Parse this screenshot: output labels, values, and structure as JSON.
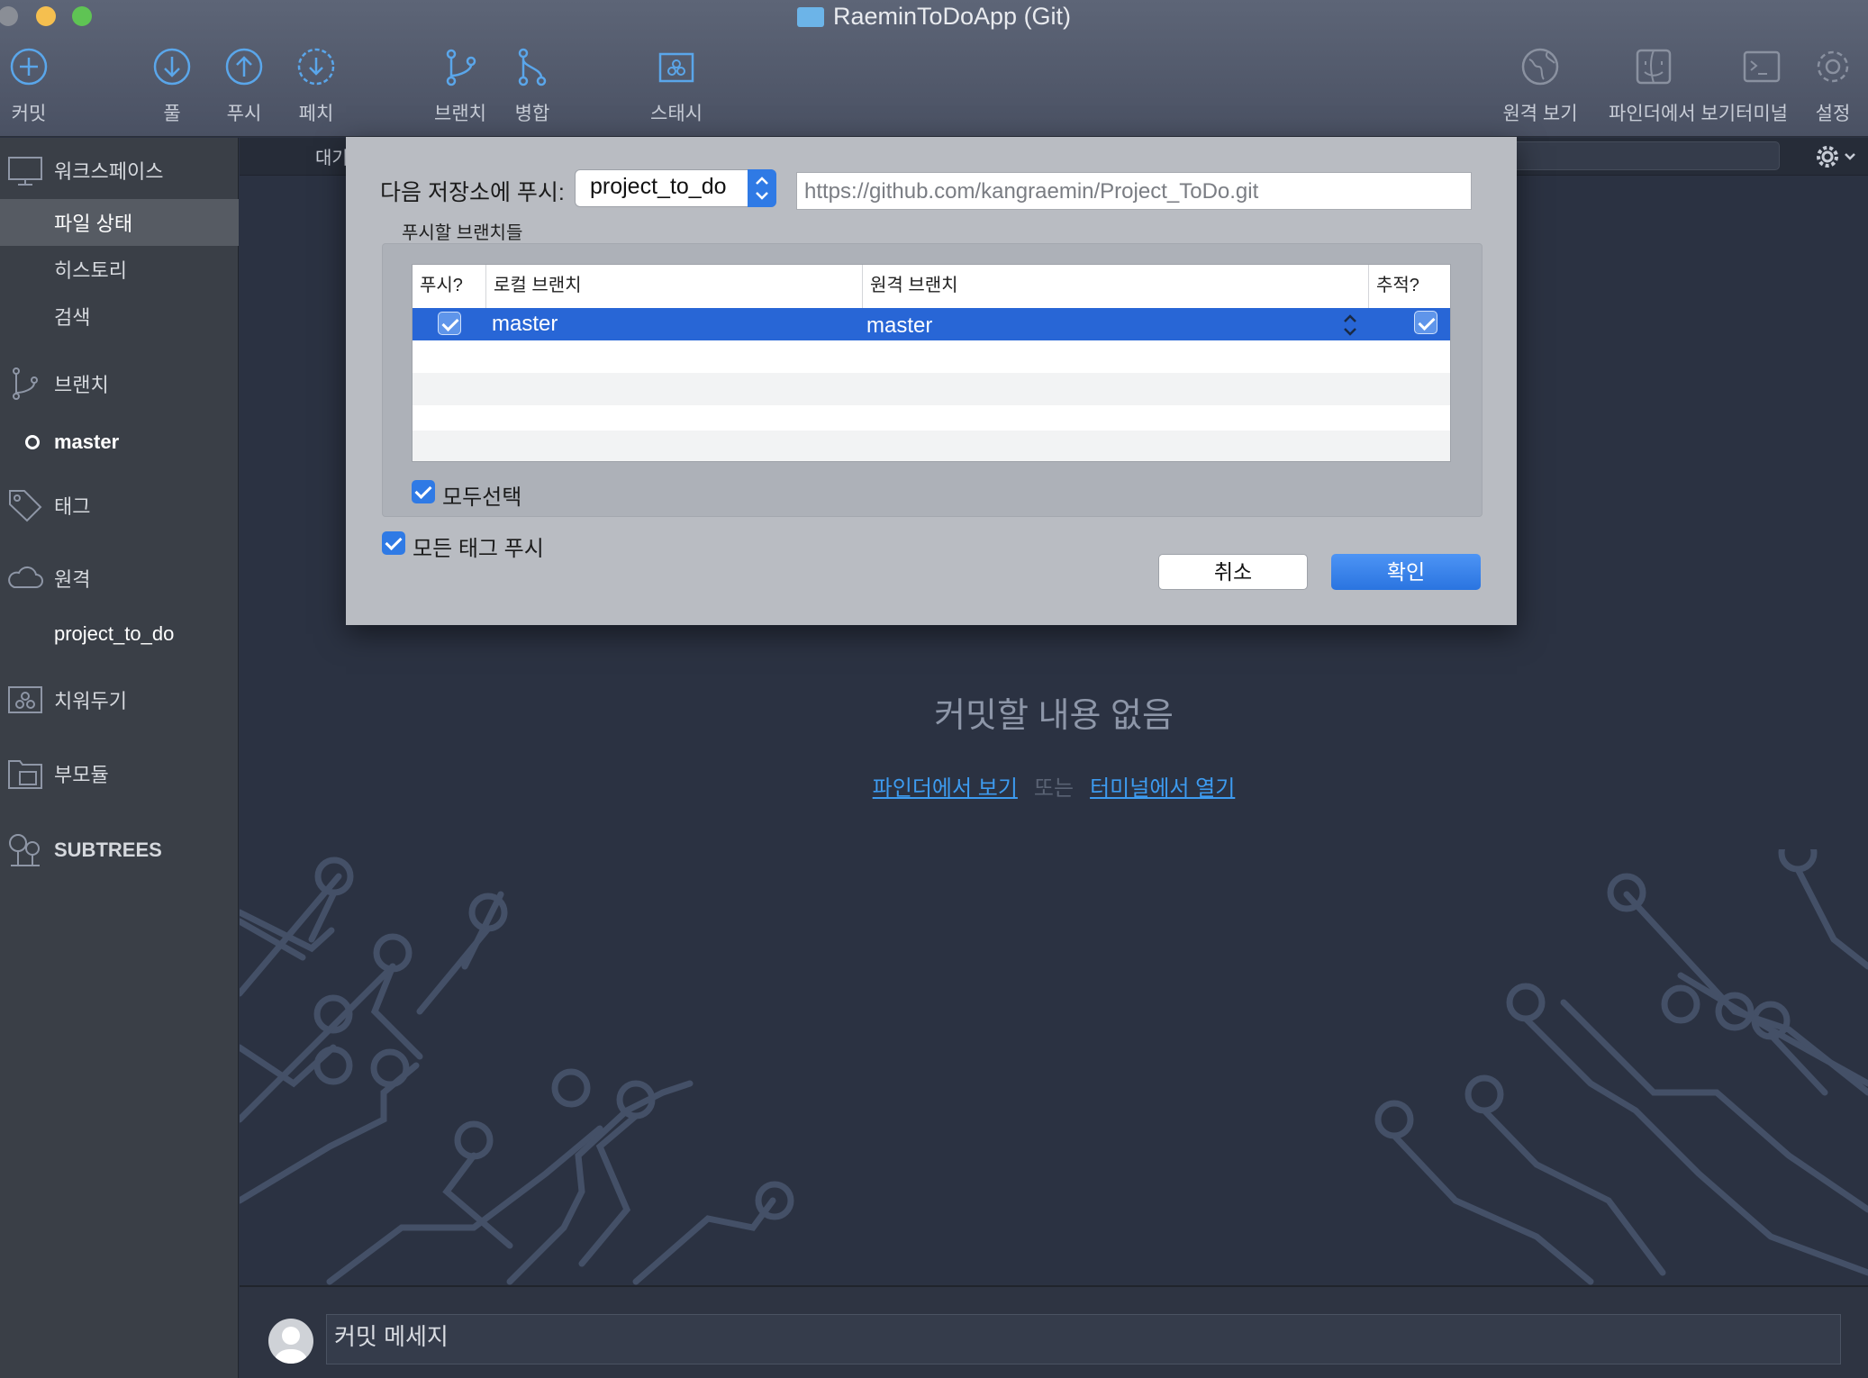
{
  "window": {
    "title": "RaeminToDoApp (Git)"
  },
  "toolbar": {
    "commit": "커밋",
    "pull": "풀",
    "push": "푸시",
    "fetch": "페치",
    "branch": "브랜치",
    "merge": "병합",
    "stash": "스태시",
    "remote_view": "원격 보기",
    "finder_view": "파인더에서 보기",
    "terminal": "터미널",
    "settings": "설정"
  },
  "sidebar": {
    "workspace": "워크스페이스",
    "file_status": "파일 상태",
    "history": "히스토리",
    "search": "검색",
    "branches": "브랜치",
    "current_branch": "master",
    "tags": "태그",
    "remotes": "원격",
    "remote_name": "project_to_do",
    "stashes": "치워두기",
    "submodules": "부모듈",
    "subtrees": "SUBTREES"
  },
  "main": {
    "tab_partial": "대기",
    "empty_message": "커밋할 내용 없음",
    "link_finder": "파인더에서 보기",
    "or": "또는",
    "link_terminal": "터미널에서 열기",
    "commit_placeholder": "커밋 메세지"
  },
  "dialog": {
    "push_to_label": "다음 저장소에 푸시:",
    "remote": "project_to_do",
    "url": "https://github.com/kangraemin/Project_ToDo.git",
    "branches_label": "푸시할 브랜치들",
    "columns": {
      "push": "푸시?",
      "local": "로컬 브랜치",
      "remote": "원격 브랜치",
      "track": "추적?"
    },
    "rows": [
      {
        "push": true,
        "local": "master",
        "remote": "master",
        "track": true
      }
    ],
    "select_all": "모두선택",
    "push_all_tags": "모든 태그 푸시",
    "cancel": "취소",
    "ok": "확인"
  },
  "colors": {
    "accent": "#2f7ae5",
    "selection": "#2866d6",
    "link": "#3d9bf0"
  }
}
